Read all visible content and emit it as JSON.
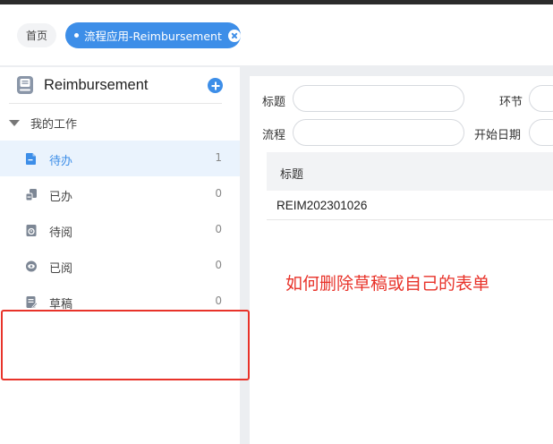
{
  "tabs": {
    "home_label": "首页",
    "active_label": "流程应用-Reimbursement"
  },
  "sidebar": {
    "title": "Reimbursement",
    "group_label": "我的工作",
    "items": [
      {
        "label": "待办",
        "count": "1",
        "icon": "todo-doc-icon",
        "active": true
      },
      {
        "label": "已办",
        "count": "0",
        "icon": "done-stamp-icon",
        "active": false
      },
      {
        "label": "待阅",
        "count": "0",
        "icon": "to-read-icon",
        "active": false
      },
      {
        "label": "已阅",
        "count": "0",
        "icon": "read-eye-icon",
        "active": false
      },
      {
        "label": "草稿",
        "count": "0",
        "icon": "draft-edit-icon",
        "active": false
      }
    ]
  },
  "filters": {
    "title_label": "标题",
    "step_label": "环节",
    "process_label": "流程",
    "start_date_label": "开始日期"
  },
  "table": {
    "header_title": "标题",
    "rows": [
      {
        "title": "REIM202301026"
      }
    ]
  },
  "annotation": {
    "text": "如何删除草稿或自己的表单"
  },
  "colors": {
    "accent": "#3d8ee8",
    "highlight_red": "#e8332a"
  }
}
